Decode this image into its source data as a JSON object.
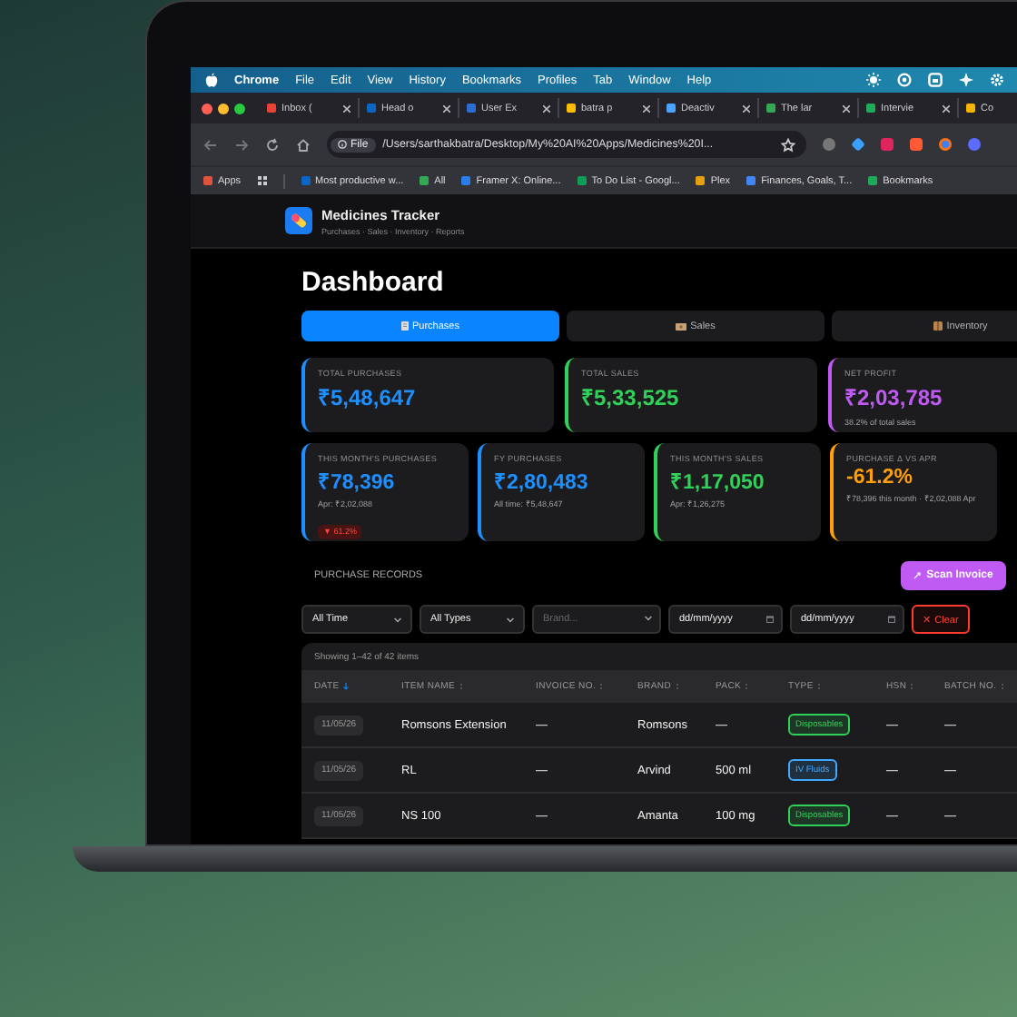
{
  "menubar": {
    "app": "Chrome",
    "items": [
      "File",
      "Edit",
      "View",
      "History",
      "Bookmarks",
      "Profiles",
      "Tab",
      "Window",
      "Help"
    ]
  },
  "browser": {
    "tabs": [
      {
        "title": "Inbox (",
        "color": "#ea4335",
        "selected": false
      },
      {
        "title": "Head o",
        "color": "#0a66c2",
        "selected": false
      },
      {
        "title": "User Ex",
        "color": "#2b6fd6",
        "selected": false
      },
      {
        "title": "batra p",
        "color": "#fbbc05",
        "selected": false
      },
      {
        "title": "Deactiv",
        "color": "#4aa3ff",
        "selected": false
      },
      {
        "title": "The lar",
        "color": "#34a853",
        "selected": false
      },
      {
        "title": "Intervie",
        "color": "#1faa59",
        "selected": false
      },
      {
        "title": "Co",
        "color": "#f4b400",
        "selected": false
      }
    ],
    "address": {
      "scheme": "File",
      "url": "/Users/sarthakbatra/Desktop/My%20AI%20Apps/Medicines%20I..."
    },
    "bookmarks": [
      {
        "label": "Apps",
        "color": "#e0533d"
      },
      {
        "label": "Most productive w...",
        "color": "#0a66c2"
      },
      {
        "label": "All",
        "color": "#34a853"
      },
      {
        "label": "Framer X: Online...",
        "color": "#2b7de9"
      },
      {
        "label": "To Do List - Googl...",
        "color": "#0f9d58"
      },
      {
        "label": "Plex",
        "color": "#e5a00d"
      },
      {
        "label": "Finances, Goals, T...",
        "color": "#4285f4"
      },
      {
        "label": "Bookmarks",
        "color": "#1faa59"
      }
    ]
  },
  "app": {
    "title": "Medicines Tracker",
    "subtitle": "Purchases · Sales · Inventory · Reports"
  },
  "page_title": "Dashboard",
  "tabs": [
    {
      "label": "Purchases",
      "selected": true
    },
    {
      "label": "Sales",
      "selected": false
    },
    {
      "label": "Inventory",
      "selected": false
    }
  ],
  "summary_cards": [
    {
      "label": "TOTAL PURCHASES",
      "value": "₹5,48,647",
      "color": "#1e8fff"
    },
    {
      "label": "TOTAL SALES",
      "value": "₹5,33,525",
      "color": "#30d158"
    },
    {
      "label": "NET PROFIT",
      "value": "₹2,03,785",
      "note": "38.2% of total sales",
      "color": "#bf5af2"
    }
  ],
  "month_cards": [
    {
      "label": "THIS MONTH'S PURCHASES",
      "value": "₹78,396",
      "note": "Apr: ₹2,02,088",
      "badge": "▼ 61.2%",
      "color": "#1e8fff"
    },
    {
      "label": "FY PURCHASES",
      "value": "₹2,80,483",
      "note": "All time: ₹5,48,647",
      "color": "#1e8fff"
    },
    {
      "label": "THIS MONTH'S SALES",
      "value": "₹1,17,050",
      "note": "Apr: ₹1,26,275",
      "color": "#30d158"
    },
    {
      "label": "PURCHASE Δ VS APR",
      "value": "-61.2%",
      "note": "₹78,396 this month · ₹2,02,088 Apr",
      "color": "#ff9f0a"
    }
  ],
  "records": {
    "title": "PURCHASE RECORDS",
    "scan_button": "Scan Invoice",
    "filters": [
      {
        "kind": "select",
        "value": "All Time"
      },
      {
        "kind": "select",
        "value": "All Types"
      },
      {
        "kind": "combo",
        "placeholder": "Brand..."
      },
      {
        "kind": "date",
        "placeholder": "dd/mm/yyyy"
      },
      {
        "kind": "date",
        "placeholder": "dd/mm/yyyy"
      }
    ],
    "clear_button": "✕ Clear"
  },
  "table": {
    "summary": "Showing 1–42 of 42 items",
    "columns": [
      {
        "label": "DATE",
        "sorted": true
      },
      {
        "label": "ITEM NAME",
        "sorted": false
      },
      {
        "label": "INVOICE NO.",
        "sorted": false
      },
      {
        "label": "BRAND",
        "sorted": false
      },
      {
        "label": "PACK",
        "sorted": false
      },
      {
        "label": "TYPE",
        "sorted": false
      },
      {
        "label": "HSN",
        "sorted": false
      },
      {
        "label": "BATCH NO.",
        "sorted": false
      }
    ],
    "rows": [
      {
        "date": "11/05/26",
        "item": "Romsons Extension",
        "invoice": "—",
        "brand": "Romsons",
        "pack": "—",
        "type": {
          "label": "Disposables",
          "color": "#30d158"
        },
        "hsn": "—",
        "batch": "—"
      },
      {
        "date": "11/05/26",
        "item": "RL",
        "invoice": "—",
        "brand": "Arvind",
        "pack": "500 ml",
        "type": {
          "label": "IV Fluids",
          "color": "#40a9ff"
        },
        "hsn": "—",
        "batch": "—"
      },
      {
        "date": "11/05/26",
        "item": "NS 100",
        "invoice": "—",
        "brand": "Amanta",
        "pack": "100 mg",
        "type": {
          "label": "Disposables",
          "color": "#30d158"
        },
        "hsn": "—",
        "batch": "—"
      }
    ]
  }
}
